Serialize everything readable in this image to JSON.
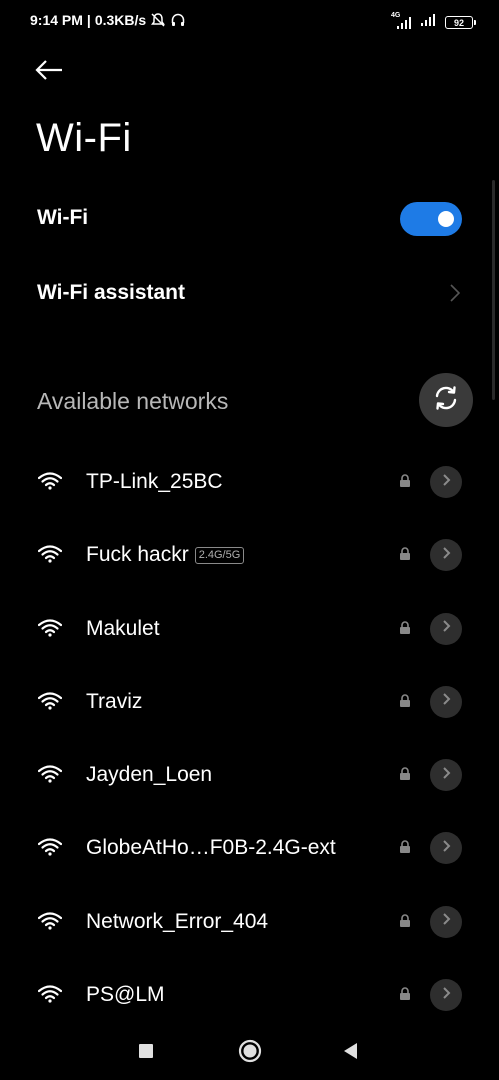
{
  "status_bar": {
    "time": "9:14 PM",
    "separator": "|",
    "speed": "0.3KB/s",
    "network_type": "4G",
    "battery": "92"
  },
  "header": {
    "title": "Wi-Fi"
  },
  "settings": {
    "wifi_label": "Wi-Fi",
    "wifi_enabled": true,
    "assistant_label": "Wi-Fi assistant"
  },
  "networks_section": {
    "title": "Available networks"
  },
  "networks": [
    {
      "name": "TP-Link_25BC",
      "badge": ""
    },
    {
      "name": "Fuck hackr",
      "badge": "2.4G/5G"
    },
    {
      "name": "Makulet",
      "badge": ""
    },
    {
      "name": "Traviz",
      "badge": ""
    },
    {
      "name": "Jayden_Loen",
      "badge": ""
    },
    {
      "name": "GlobeAtHo…F0B-2.4G-ext",
      "badge": ""
    },
    {
      "name": "Network_Error_404",
      "badge": ""
    },
    {
      "name": "PS@LM",
      "badge": ""
    }
  ],
  "colors": {
    "background": "#000000",
    "accent": "#1e7be6",
    "secondary_text": "#b8b8b8",
    "detail_button_bg": "#2e2e2e"
  },
  "icons": {
    "back": "arrow-left-icon",
    "refresh": "refresh-icon",
    "wifi": "wifi-icon",
    "lock": "lock-icon",
    "detail": "chevron-right-icon",
    "nav_recent": "square-icon",
    "nav_home": "circle-icon",
    "nav_back": "triangle-back-icon"
  }
}
